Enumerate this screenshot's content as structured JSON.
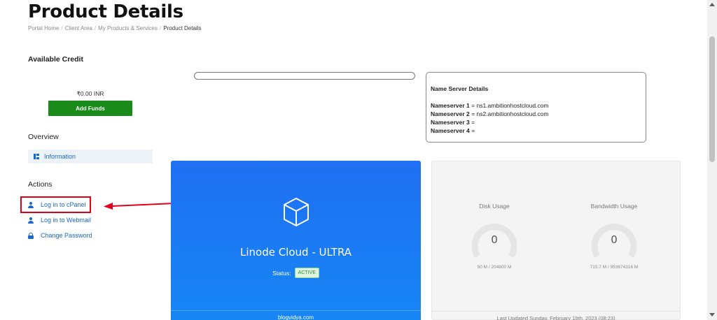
{
  "page": {
    "title": "Product Details"
  },
  "breadcrumb": {
    "items": [
      "Portal Home",
      "Client Area",
      "My Products & Services"
    ],
    "current": "Product Details",
    "separator": "/"
  },
  "sidebar": {
    "credit_heading": "Available Credit",
    "credit_amount": "₹0.00 INR",
    "add_funds_label": "Add Funds",
    "overview_heading": "Overview",
    "overview_items": [
      {
        "label": "Information",
        "icon": "info-grid-icon"
      }
    ],
    "actions_heading": "Actions",
    "actions": [
      {
        "label": "Log in to cPanel",
        "icon": "user-icon"
      },
      {
        "label": "Log in to Webmail",
        "icon": "user-icon"
      },
      {
        "label": "Change Password",
        "icon": "lock-icon"
      }
    ]
  },
  "nameservers": {
    "title": "Name Server Details",
    "rows": [
      {
        "label": "Nameserver 1",
        "value": "= ns1.ambitionhostcloud.com"
      },
      {
        "label": "Nameserver 2",
        "value": "= ns2.ambitionhostcloud.com"
      },
      {
        "label": "Nameserver 3",
        "value": "="
      },
      {
        "label": "Nameserver 4",
        "value": "="
      }
    ]
  },
  "product": {
    "name": "Linode Cloud - ULTRA",
    "status_label": "Status:",
    "status_value": "ACTIVE",
    "footer": "blogvidya.com",
    "icon": "cube-icon"
  },
  "usage": {
    "disk": {
      "label": "Disk Usage",
      "value": "0",
      "detail": "50 M / 204800 M"
    },
    "bandwidth": {
      "label": "Bandwidth Usage",
      "value": "0",
      "detail": "715.7 M / 953674316 M"
    },
    "last_updated": "Last Updated Sunday, February 19th, 2023 (08:23)"
  },
  "colors": {
    "accent": "#1a66c9",
    "add_funds": "#1a8a1a",
    "product_panel": "#1f6ff2",
    "highlight": "#e3001b"
  }
}
